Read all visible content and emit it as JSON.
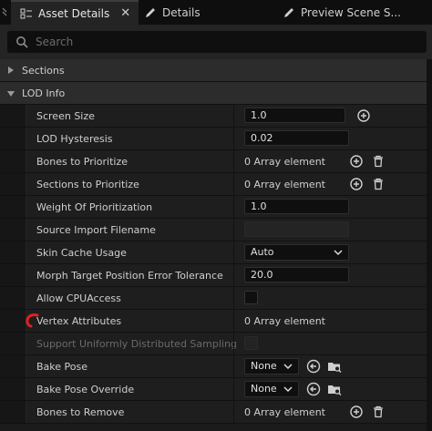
{
  "tabs": [
    {
      "label": "Asset Details",
      "icon": "asset-details-icon",
      "active": true,
      "close": "✕"
    },
    {
      "label": "Details",
      "icon": "pencil-icon",
      "active": false
    },
    {
      "label": "Preview Scene S...",
      "icon": "pencil-icon",
      "active": false
    }
  ],
  "search": {
    "placeholder": "Search"
  },
  "categories": {
    "sections": "Sections",
    "lod_info": "LOD Info"
  },
  "props": {
    "screen_size": {
      "label": "Screen Size",
      "value": "1.0"
    },
    "lod_hysteresis": {
      "label": "LOD Hysteresis",
      "value": "0.02"
    },
    "bones_to_prioritize": {
      "label": "Bones to Prioritize",
      "value": "0 Array element"
    },
    "sections_to_prioritize": {
      "label": "Sections to Prioritize",
      "value": "0 Array element"
    },
    "weight_of_prioritization": {
      "label": "Weight Of Prioritization",
      "value": "1.0"
    },
    "source_import_filename": {
      "label": "Source Import Filename",
      "value": ""
    },
    "skin_cache_usage": {
      "label": "Skin Cache Usage",
      "value": "Auto"
    },
    "morph_target_tolerance": {
      "label": "Morph Target Position Error Tolerance",
      "value": "20.0"
    },
    "allow_cpu_access": {
      "label": "Allow CPUAccess",
      "checked": false
    },
    "vertex_attributes": {
      "label": "Vertex Attributes",
      "value": "0 Array element"
    },
    "support_uniform_sampling": {
      "label": "Support Uniformly Distributed Sampling",
      "checked": false,
      "disabled": true
    },
    "bake_pose": {
      "label": "Bake Pose",
      "value": "None"
    },
    "bake_pose_override": {
      "label": "Bake Pose Override",
      "value": "None"
    },
    "bones_to_remove": {
      "label": "Bones to Remove",
      "value": "0 Array element"
    }
  },
  "colors": {
    "accent_red": "#e02020",
    "panel_bg": "#1e1e1e",
    "category_bg": "#2c2c2c"
  }
}
